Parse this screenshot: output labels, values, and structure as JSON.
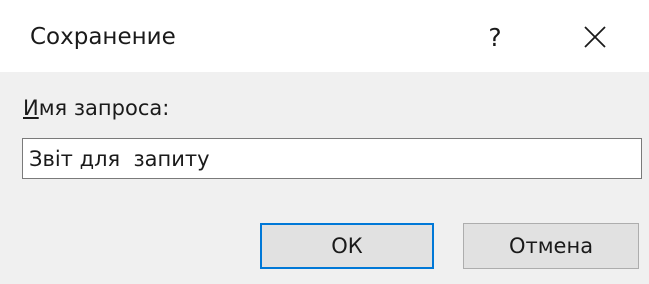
{
  "dialog": {
    "title": "Сохранение",
    "help_label": "?",
    "field": {
      "label_access_key": "И",
      "label_rest": "мя запроса:",
      "value": "Звіт для  запиту"
    },
    "buttons": {
      "ok_label": "ОК",
      "cancel_label": "Отмена"
    }
  },
  "colors": {
    "accent": "#0078d7",
    "dialog_bg": "#f0f0f0"
  },
  "icons": [
    "close-icon"
  ]
}
